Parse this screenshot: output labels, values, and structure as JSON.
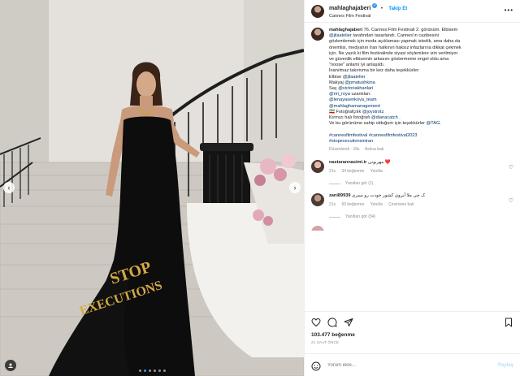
{
  "post": {
    "username": "mahlaghajaberi",
    "follow_label": "Takip Et",
    "location": "Cannes Film Festival",
    "more_icon": "more-horizontal-icon"
  },
  "caption": {
    "username": "mahlaghajaberi",
    "lines": [
      "76. Cannes Film Festivali 2. görünüm. Elbisem",
      "@jilaatelier tarafından tasarlandı. Cannes'ın cazibesini",
      "gözlemlemek için moda açıklaması yapmak istedik, ama daha da",
      "önemlisi, medyanın İran halkının haksız infazlarına dikkat çekmek",
      "için. Ne yazık ki film festivalinde siyasi söylemlere izin verilmiyor",
      "ve güvenlik elbisemin arkasını göstermeme engel oldu ama",
      "\"noose\" anlamı iyi anlaşıldı.",
      "İnanılmaz takımıma bir kez daha teşekkürler:",
      "Elbise @jilaatelier",
      "Makyaj @pmatushkina",
      "Saç @victoriakhanlari",
      "@riri_roya uzantıları.",
      "@lenayasenkova_team",
      "@mahlaghamanagement",
      "🇮🇷 Fotoğrafçılık @joystrotz",
      "Kırmızı halı fotoğrafı @dianacatch .",
      "Ve bu görünüme sahip olduğum için teşekkürler @TAG.",
      "",
      "#cannesfilmfestival #cannesfilmfestival2023",
      "#stopexecutionsiniran"
    ],
    "edited": "Düzenlendi · 18s",
    "translate": "Aslına bak"
  },
  "comments": [
    {
      "username": "nastarannasimi.ir",
      "text": "مهربونی ❤️",
      "time": "21s",
      "likes": "34 beğenme",
      "reply": "Yanıtla",
      "translate": "",
      "replies": "Yanıtları gör (1)",
      "avatar_color": "#e8b8a8"
    },
    {
      "username": "zani89939",
      "text": "ک چی ملا آبروی کشور خودت رو میبری",
      "time": "21s",
      "likes": "50 beğenme",
      "reply": "Yanıtla",
      "translate": "Çevirisine bak",
      "replies": "Yanıtları gör (94)",
      "avatar_color": "#b89a86"
    }
  ],
  "actions": {
    "likes": "103.477 beğenme",
    "time": "21 SAAT ÖNCE"
  },
  "composer": {
    "placeholder": "Yorum ekle...",
    "post_label": "Paylaş"
  },
  "photo": {
    "text_on_dress_line1": "STOP",
    "text_on_dress_line2": "EXECUTIONS"
  },
  "colors": {
    "link": "#00376b",
    "accent": "#0095f6"
  }
}
